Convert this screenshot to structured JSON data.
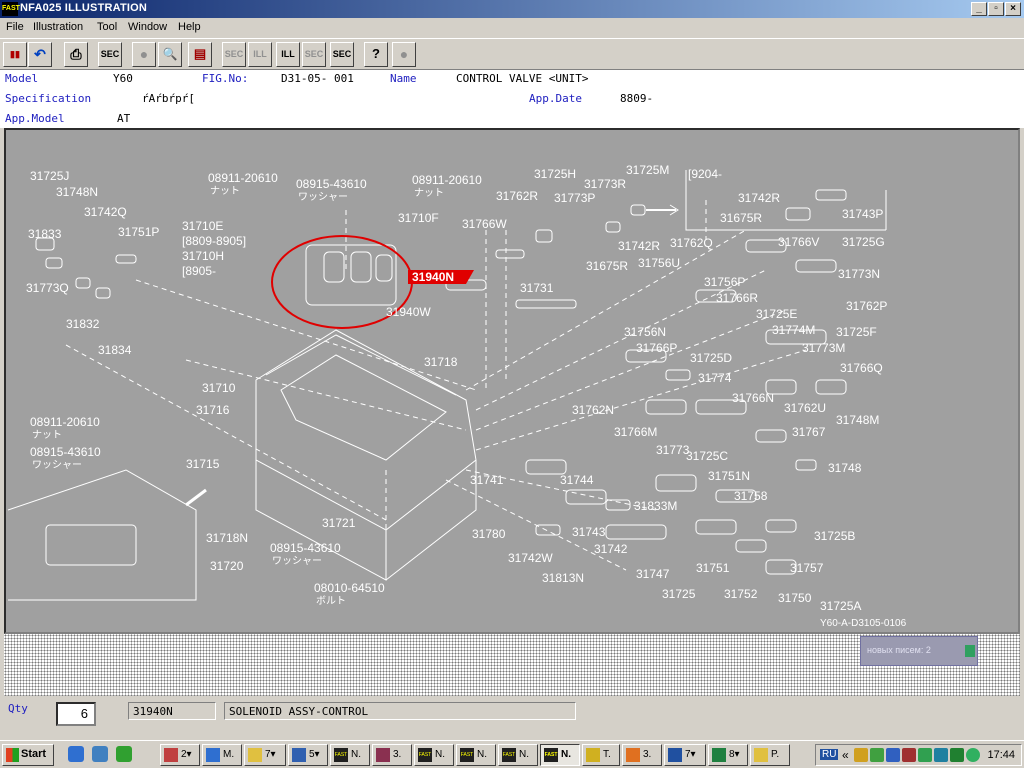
{
  "window": {
    "app_icon": "FAST",
    "title": "NFA025 ILLUSTRATION",
    "controls": [
      "_",
      "▫",
      "×"
    ]
  },
  "menu": [
    "File",
    "Illustration",
    "Tool",
    "Window",
    "Help"
  ],
  "toolbar": {
    "buttons": [
      {
        "name": "exit-icon",
        "label": ""
      },
      {
        "name": "back-icon",
        "label": "↶"
      },
      {
        "name": "print-icon",
        "label": "⎙"
      },
      {
        "name": "sec-button",
        "label": "SEC"
      },
      {
        "name": "circle-icon",
        "label": "●"
      },
      {
        "name": "zoom-icon",
        "label": "🔍"
      },
      {
        "name": "catalog-icon",
        "label": "▤"
      },
      {
        "name": "prev-sec-icon",
        "label": "SEC"
      },
      {
        "name": "prev-ill-icon",
        "label": "ILL"
      },
      {
        "name": "next-ill-icon",
        "label": "ILL"
      },
      {
        "name": "next-sec-icon",
        "label": "SEC"
      },
      {
        "name": "search-sec-icon",
        "label": "SEC"
      },
      {
        "name": "help-icon",
        "label": "?"
      },
      {
        "name": "stop-icon",
        "label": "●"
      }
    ]
  },
  "info": {
    "model_label": "Model",
    "model": "Y60",
    "fig_label": "FIG.No:",
    "fig": "D31-05- 001",
    "name_label": "Name",
    "name": "CONTROL VALVE <UNIT>",
    "spec_label": "Specification",
    "spec": "ŕAŕbŕpŕ[",
    "appdate_label": "App.Date",
    "appdate": "8809-",
    "appmodel_label": "App.Model",
    "appmodel": "AT"
  },
  "illustration": {
    "highlighted_part": "31940N",
    "drawing_code": "Y60-A-D3105-0106",
    "parts": [
      "31725J",
      "31748N",
      "31742Q",
      "31833",
      "31751P",
      "31773Q",
      "31832",
      "31834",
      "08911-20610",
      "ナット",
      "08915-43610",
      "ワッシャー",
      "31710E",
      "[8809-8905]",
      "31710H",
      "[8905-",
      "08911-20610",
      "ナット",
      "31710F",
      "31766W",
      "31762R",
      "31725H",
      "31773R",
      "31773P",
      "31725M",
      "[9204-",
      "31742R",
      "31675R",
      "31743P",
      "31742R",
      "31762Q",
      "31766V",
      "31725G",
      "31675R",
      "31756U",
      "31773N",
      "31940W",
      "31731",
      "31756P",
      "31766R",
      "31762P",
      "31725E",
      "31774M",
      "31725F",
      "31773M",
      "31756N",
      "31766P",
      "31725D",
      "31766Q",
      "31718",
      "31710",
      "31716",
      "31774",
      "31762N",
      "31766N",
      "31762U",
      "31748M",
      "08911-20610",
      "ナット",
      "08915-43610",
      "ワッシャー",
      "31715",
      "31766M",
      "31773",
      "31725C",
      "31767",
      "31748",
      "31741",
      "31744",
      "31751N",
      "31758",
      "31833M",
      "31718N",
      "31721",
      "31743",
      "31725B",
      "31780",
      "31742",
      "31742W",
      "08915-43610",
      "ワッシャー",
      "31720",
      "31813N",
      "31747",
      "31751",
      "31757",
      "31752",
      "08010-64510",
      "ボルト",
      "31725",
      "31750",
      "31725A"
    ]
  },
  "notification": "новых писем: 2",
  "bottom": {
    "qty_label": "Qty",
    "qty": "6",
    "part_no": "31940N",
    "part_name": "SOLENOID ASSY-CONTROL"
  },
  "taskbar": {
    "start": "Start",
    "tasks": [
      "2▾",
      "M.",
      "7▾",
      "5▾",
      "N.",
      "3.",
      "N.",
      "N.",
      "N.",
      "N.",
      "T.",
      "3.",
      "7▾",
      "8▾",
      "P."
    ],
    "lang": "RU",
    "clock": "17:44"
  }
}
